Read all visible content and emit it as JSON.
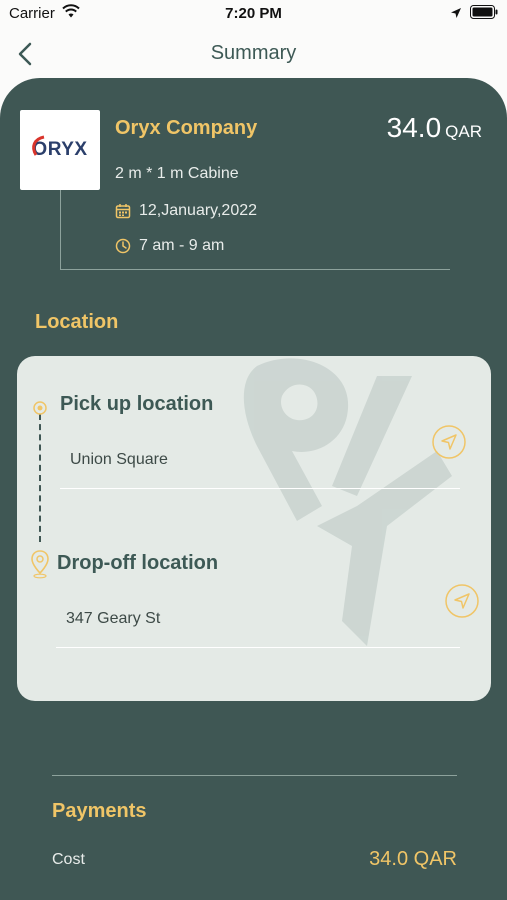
{
  "status_bar": {
    "carrier": "Carrier",
    "time": "7:20 PM"
  },
  "nav": {
    "title": "Summary",
    "back_icon": "chevron-left-icon"
  },
  "booking": {
    "logo_text": "ORYX",
    "company": "Oryx Company",
    "price_value": "34.0",
    "price_currency": "QAR",
    "size": "2 m * 1 m Cabine",
    "date": "12,January,2022",
    "time": "7 am - 9 am"
  },
  "location": {
    "heading": "Location",
    "pickup_label": "Pick up location",
    "pickup_value": "Union Square",
    "dropoff_label": "Drop-off location",
    "dropoff_value": "347 Geary St"
  },
  "payments": {
    "heading": "Payments",
    "rows": [
      {
        "label": "Cost",
        "value": "34.0 QAR"
      },
      {
        "label": "",
        "value": ""
      }
    ]
  },
  "colors": {
    "sheet_bg": "#3f5754",
    "accent_gold": "#f0c567",
    "card_bg": "#e4eae6",
    "nav_title": "#3d5955"
  }
}
